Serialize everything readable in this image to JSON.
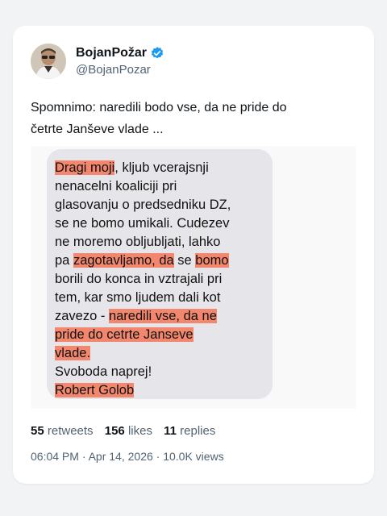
{
  "author": {
    "display_name": "BojanPožar",
    "handle": "@BojanPozar",
    "avatar_icon": "avatar-photo",
    "verified_icon": "verified-badge-icon",
    "verified_color": "#1d9bf0"
  },
  "tweet": {
    "line1": "Spomnimo: naredili bodo vse, da ne pride do",
    "line2": "četrte Janševe vlade ..."
  },
  "message": {
    "highlight_color": "#f2876d",
    "l1a": "Dragi moji",
    "l1b": ", kljub vcerajsnji",
    "l2": "nenacelni koaliciji pri",
    "l3": "glasovanju o predsedniku DZ,",
    "l4": "se ne bomo umikali. Cudezev",
    "l5": "ne moremo obljubljati, lahko",
    "l6a": "pa ",
    "l6b": "zagotavljamo, da",
    "l6c": " se ",
    "l6d": "bomo",
    "l7": "borili do konca in vztrajali pri",
    "l8": "tem, kar smo ljudem dali kot",
    "l9a": "zavezo - ",
    "l9b": "naredili vse, da ne",
    "l10": "pride do cetrte Janseve",
    "l11": "vlade.",
    "l12": "Svoboda naprej!",
    "l13": "Robert Golob"
  },
  "stats": {
    "retweets_count": "55",
    "retweets_label": "retweets",
    "likes_count": "156",
    "likes_label": "likes",
    "replies_count": "11",
    "replies_label": "replies"
  },
  "meta": {
    "text": "06:04 PM · Apr 14, 2026 · 10.0K views"
  }
}
